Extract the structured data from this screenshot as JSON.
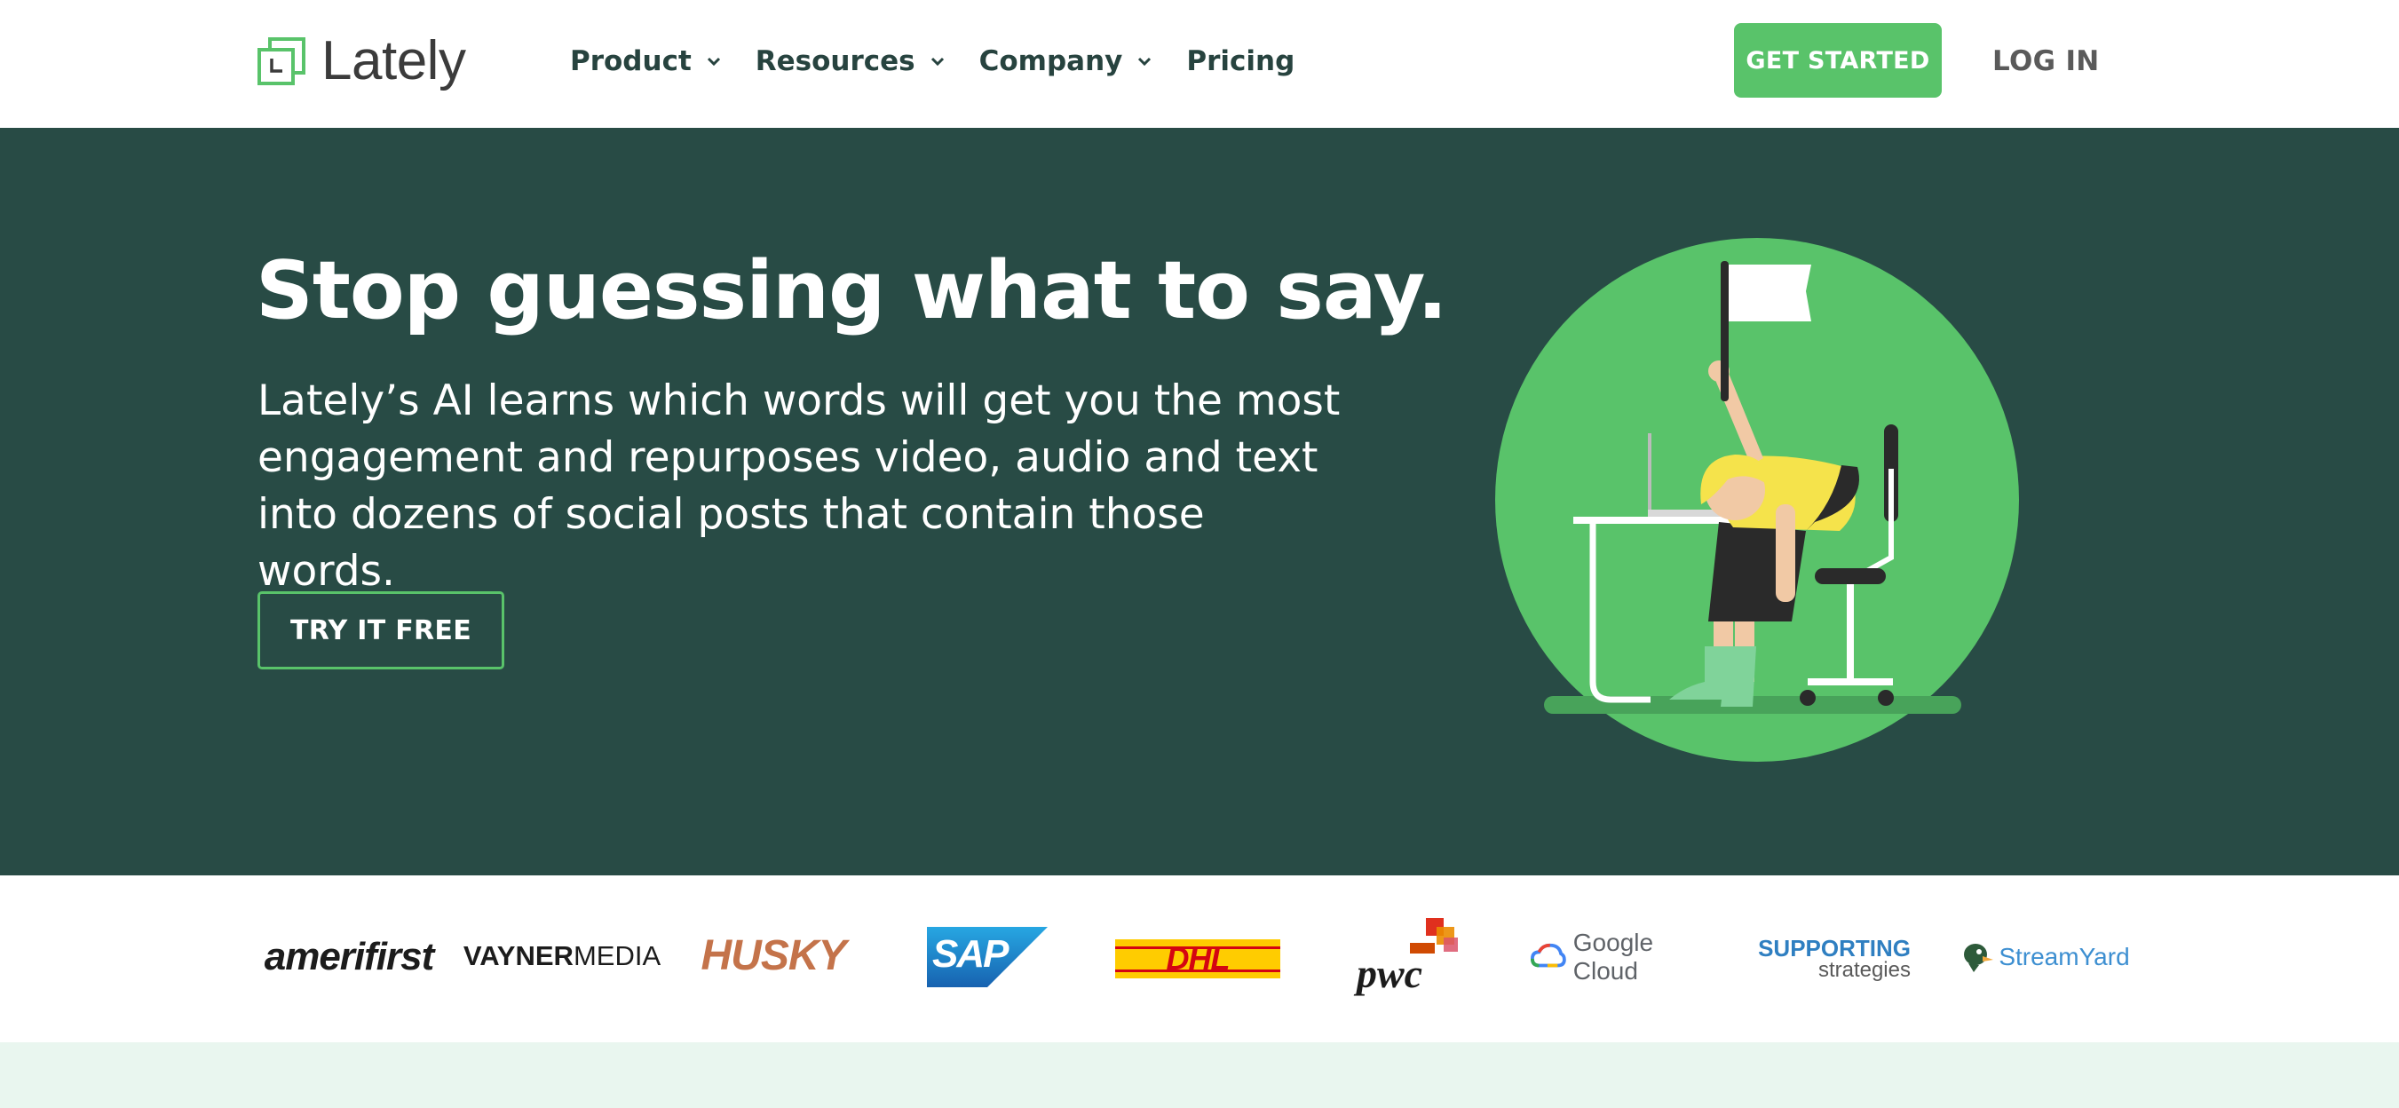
{
  "header": {
    "logo_text": "Lately",
    "nav": [
      {
        "label": "Product",
        "dropdown": true
      },
      {
        "label": "Resources",
        "dropdown": true
      },
      {
        "label": "Company",
        "dropdown": true
      },
      {
        "label": "Pricing",
        "dropdown": false
      }
    ],
    "get_started": "GET STARTED",
    "login": "LOG IN"
  },
  "hero": {
    "title": "Stop guessing what to say.",
    "subtitle": "Lately’s AI learns which words will get you the most engagement and repurposes video, audio and text into dozens of social posts that contain those words.",
    "cta": "TRY IT FREE",
    "illustration": "person-slumped-at-desk-waving-white-flag"
  },
  "logos": {
    "amerifirst": "amerifirst",
    "vayner_bold": "VAYNER",
    "vayner_light": "MEDIA",
    "husky": "HUSKY",
    "sap": "SAP",
    "dhl": "DHL",
    "pwc": "pwc",
    "google_cloud": "Google Cloud",
    "supporting_line1": "SUPPORTING",
    "supporting_line2": "strategies",
    "streamyard": "StreamYard"
  },
  "colors": {
    "brand_green": "#59c36a",
    "hero_bg": "#284b45",
    "nav_text": "#27433f",
    "bottom_band": "#e9f6ef"
  }
}
